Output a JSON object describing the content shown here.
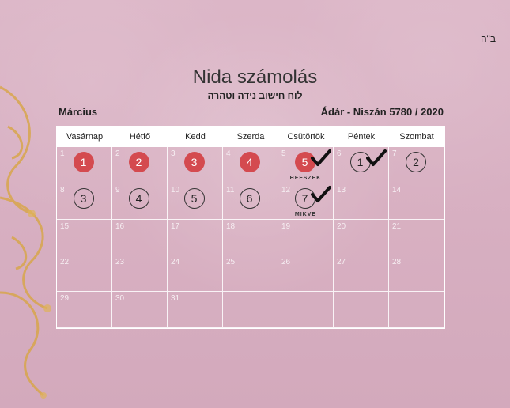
{
  "corner_mark": "ב\"ה",
  "header": {
    "title": "Nida számolás",
    "subtitle": "לוח חישוב נידה וטהרה",
    "month": "Március",
    "hebrew_month": "Ádár - Niszán 5780 / 2020"
  },
  "weekdays": [
    "Vasárnap",
    "Hétfő",
    "Kedd",
    "Szerda",
    "Csütörtök",
    "Péntek",
    "Szombat"
  ],
  "colors": {
    "red_marker": "#d44a4f",
    "background": "#d9b1c2"
  },
  "weeks": [
    [
      {
        "day": "1",
        "marker": "1",
        "style": "red"
      },
      {
        "day": "2",
        "marker": "2",
        "style": "red"
      },
      {
        "day": "3",
        "marker": "3",
        "style": "red"
      },
      {
        "day": "4",
        "marker": "4",
        "style": "red"
      },
      {
        "day": "5",
        "marker": "5",
        "style": "red",
        "check": true,
        "label": "HEFSZEK"
      },
      {
        "day": "6",
        "marker": "1",
        "style": "outline",
        "check": true
      },
      {
        "day": "7",
        "marker": "2",
        "style": "outline"
      }
    ],
    [
      {
        "day": "8",
        "marker": "3",
        "style": "outline"
      },
      {
        "day": "9",
        "marker": "4",
        "style": "outline"
      },
      {
        "day": "10",
        "marker": "5",
        "style": "outline"
      },
      {
        "day": "11",
        "marker": "6",
        "style": "outline"
      },
      {
        "day": "12",
        "marker": "7",
        "style": "outline",
        "check": true,
        "label": "MIKVE"
      },
      {
        "day": "13"
      },
      {
        "day": "14"
      }
    ],
    [
      {
        "day": "15"
      },
      {
        "day": "16"
      },
      {
        "day": "17"
      },
      {
        "day": "18"
      },
      {
        "day": "19"
      },
      {
        "day": "20"
      },
      {
        "day": "21"
      }
    ],
    [
      {
        "day": "22"
      },
      {
        "day": "23"
      },
      {
        "day": "24"
      },
      {
        "day": "25"
      },
      {
        "day": "26"
      },
      {
        "day": "27"
      },
      {
        "day": "28"
      }
    ],
    [
      {
        "day": "29"
      },
      {
        "day": "30"
      },
      {
        "day": "31"
      },
      {
        "day": ""
      },
      {
        "day": ""
      },
      {
        "day": ""
      },
      {
        "day": ""
      }
    ]
  ]
}
